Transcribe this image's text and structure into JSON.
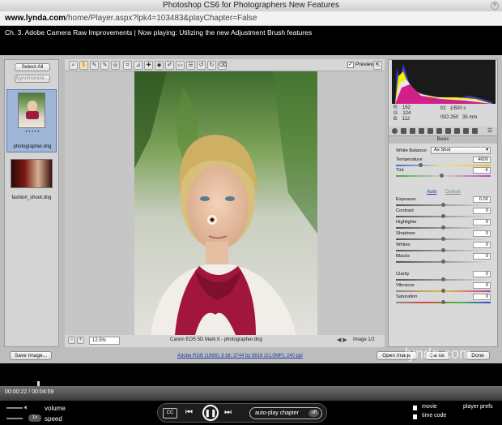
{
  "window": {
    "title": "Photoshop CS6 for Photographers New Features"
  },
  "address": {
    "domain": "www.lynda.com",
    "path": "/home/Player.aspx?lpk4=103483&playChapter=False"
  },
  "chapter": {
    "text": "Ch. 3. Adobe Camera Raw Improvements | Now playing: Utilizing the new Adjustment Brush features"
  },
  "filmstrip": {
    "select_all": "Select All",
    "synchronize": "Synchronize...",
    "items": [
      {
        "label": "photographer.dng",
        "rating": "• • • • •"
      },
      {
        "label": "fashion_shoot.dng"
      }
    ]
  },
  "toolbar": {
    "preview_label": "Preview"
  },
  "status": {
    "zoom": "12.5%",
    "caption": "Canon EOS 5D Mark II  -  photographer.dng",
    "image_count": "Image 1/2"
  },
  "readout": {
    "r": "R:   162",
    "g": "G:   124",
    "b": "B:   112",
    "aperture": "f/2   1/500 s",
    "iso": "ISO 250   35 mm"
  },
  "basic": {
    "panel_title": "Basic",
    "white_balance_label": "White Balance:",
    "white_balance_value": "As Shot",
    "auto": "Auto",
    "default": "Default",
    "sliders": [
      {
        "name": "Temperature",
        "value": "4600",
        "pos": 0.25
      },
      {
        "name": "Tint",
        "value": "-6",
        "pos": 0.48
      },
      {
        "name": "Exposure",
        "value": "0.00",
        "pos": 0.5
      },
      {
        "name": "Contrast",
        "value": "0",
        "pos": 0.5
      },
      {
        "name": "Highlights",
        "value": "0",
        "pos": 0.5
      },
      {
        "name": "Shadows",
        "value": "0",
        "pos": 0.5
      },
      {
        "name": "Whites",
        "value": "0",
        "pos": 0.5
      },
      {
        "name": "Blacks",
        "value": "0",
        "pos": 0.5
      },
      {
        "name": "Clarity",
        "value": "0",
        "pos": 0.5
      },
      {
        "name": "Vibrance",
        "value": "0",
        "pos": 0.5
      },
      {
        "name": "Saturation",
        "value": "0",
        "pos": 0.5
      }
    ]
  },
  "bottom": {
    "save_image": "Save Image...",
    "workflow_link": "Adobe RGB (1998); 8 bit; 3744 by 5616 (21.0MP); 240 ppi",
    "open_image": "Open Image",
    "cancel": "Cancel",
    "done": "Done",
    "watermark": "lynda.com"
  },
  "player": {
    "time": "00:00:22 / 00:04:59",
    "progress": 0.074,
    "volume_label": "volume",
    "speed_label": "speed",
    "speed_value": "1x",
    "cc_label": "CC",
    "autoplay_label": "auto-play chapter",
    "autoplay_state": "off",
    "movie_label": "movie",
    "timecode_label": "time code",
    "player_prefs": "player prefs"
  },
  "colors": {
    "link": "#1a3ea8",
    "accent": "#3a6fd8"
  }
}
